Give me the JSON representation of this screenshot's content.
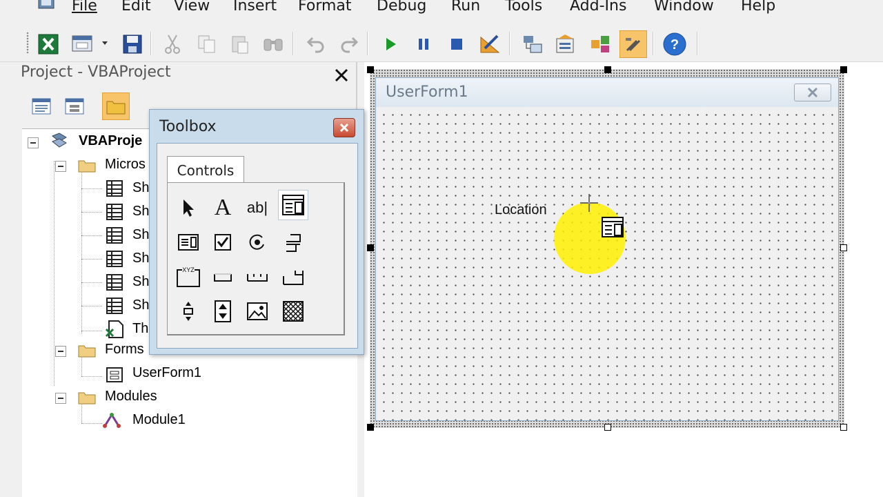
{
  "menubar": {
    "items": [
      {
        "label": "File"
      },
      {
        "label": "Edit"
      },
      {
        "label": "View"
      },
      {
        "label": "Insert"
      },
      {
        "label": "Format"
      },
      {
        "label": "Debug"
      },
      {
        "label": "Run"
      },
      {
        "label": "Tools"
      },
      {
        "label": "Add-Ins"
      },
      {
        "label": "Window"
      },
      {
        "label": "Help"
      }
    ]
  },
  "toolbar": {
    "icons": [
      "excel-icon",
      "insert-userform-icon",
      "save-icon",
      "cut-icon",
      "copy-icon",
      "paste-icon",
      "find-icon",
      "undo-icon",
      "redo-icon",
      "run-icon",
      "break-icon",
      "reset-icon",
      "design-mode-icon",
      "project-explorer-icon",
      "properties-icon",
      "object-browser-icon",
      "toolbox-icon",
      "help-icon"
    ]
  },
  "project": {
    "title": "Project - VBAProject",
    "tree": {
      "root": "VBAProje",
      "microsoft": "Micros",
      "sheets": [
        "Sh",
        "Sh",
        "Sh",
        "Sh",
        "Sh",
        "Sh"
      ],
      "thisworkbook": "Th",
      "forms": "Forms",
      "userform": "UserForm1",
      "modules": "Modules",
      "module": "Module1"
    }
  },
  "toolbox": {
    "title": "Toolbox",
    "tab": "Controls",
    "controls": [
      "select-objects",
      "label",
      "textbox",
      "combobox",
      "listbox",
      "checkbox",
      "optionbutton",
      "togglebutton",
      "frame",
      "commandbutton",
      "tabstrip",
      "multipage",
      "scrollbar",
      "spinbutton",
      "image",
      "refedit"
    ],
    "text_glyphs": {
      "label": "A",
      "textbox": "ab|",
      "frame": "XYZ"
    }
  },
  "userform": {
    "title": "UserForm1",
    "label_text": "Location"
  },
  "colors": {
    "highlight": "#fff000",
    "active_button": "#f7c46a",
    "toolbox_frame": "#c9dceb"
  }
}
